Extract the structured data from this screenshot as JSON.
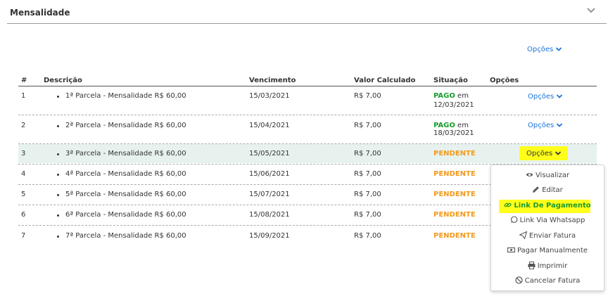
{
  "panel": {
    "title": "Mensalidade"
  },
  "top_options_label": "Opções",
  "table": {
    "headers": [
      "#",
      "Descrição",
      "Vencimento",
      "Valor Calculado",
      "Situação",
      "Opções"
    ],
    "rows": [
      {
        "num": "1",
        "desc": "1ª Parcela - Mensalidade R$ 60,00",
        "due": "15/03/2021",
        "value": "R$ 7,00",
        "status": "PAGO",
        "status_suffix": "em",
        "status_date": "12/03/2021",
        "options": "Opções"
      },
      {
        "num": "2",
        "desc": "2ª Parcela - Mensalidade R$ 60,00",
        "due": "15/04/2021",
        "value": "R$ 7,00",
        "status": "PAGO",
        "status_suffix": "em",
        "status_date": "18/03/2021",
        "options": "Opções"
      },
      {
        "num": "3",
        "desc": "3ª Parcela - Mensalidade R$ 60,00",
        "due": "15/05/2021",
        "value": "R$ 7,00",
        "status": "PENDENTE",
        "options": "Opções"
      },
      {
        "num": "4",
        "desc": "4ª Parcela - Mensalidade R$ 60,00",
        "due": "15/06/2021",
        "value": "R$ 7,00",
        "status": "PENDENTE"
      },
      {
        "num": "5",
        "desc": "5ª Parcela - Mensalidade R$ 60,00",
        "due": "15/07/2021",
        "value": "R$ 7,00",
        "status": "PENDENTE"
      },
      {
        "num": "6",
        "desc": "6ª Parcela - Mensalidade R$ 60,00",
        "due": "15/08/2021",
        "value": "R$ 7,00",
        "status": "PENDENTE"
      },
      {
        "num": "7",
        "desc": "7ª Parcela - Mensalidade R$ 60,00",
        "due": "15/09/2021",
        "value": "R$ 7,00",
        "status": "PENDENTE"
      }
    ]
  },
  "menu": {
    "items": [
      {
        "label": "Visualizar",
        "icon": "eye-icon"
      },
      {
        "label": "Editar",
        "icon": "pencil-icon"
      },
      {
        "label": "Link De Pagamento",
        "icon": "link-icon"
      },
      {
        "label": "Link Via Whatsapp",
        "icon": "whatsapp-icon"
      },
      {
        "label": "Enviar Fatura",
        "icon": "paper-plane-icon"
      },
      {
        "label": "Pagar Manualmente",
        "icon": "money-icon"
      },
      {
        "label": "Imprimir",
        "icon": "printer-icon"
      },
      {
        "label": "Cancelar Fatura",
        "icon": "ban-icon"
      }
    ]
  },
  "colors": {
    "link": "#1a73d9",
    "paid": "#1a9c2c",
    "pending": "#f29a1e",
    "highlight": "#ffff1a",
    "selected_row": "#e7f2ee"
  }
}
